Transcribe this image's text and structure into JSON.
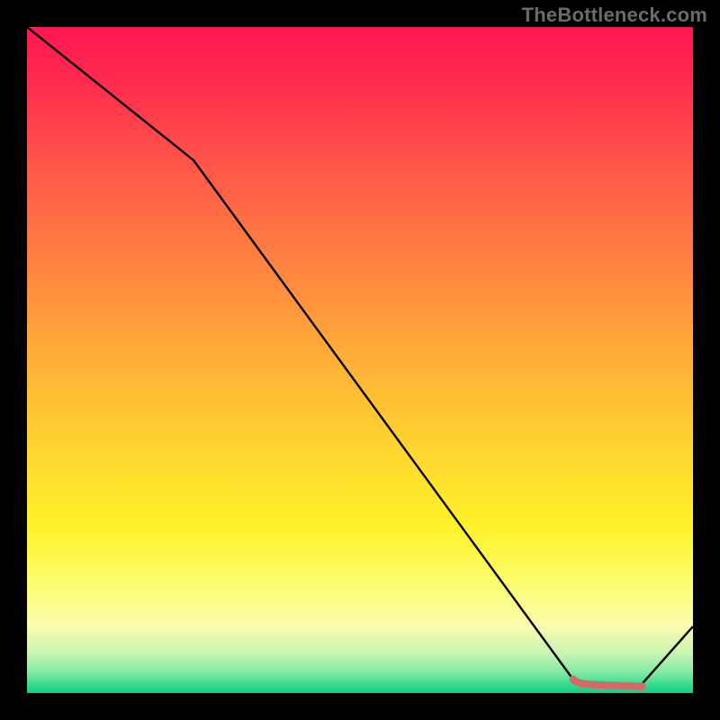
{
  "attribution": "TheBottleneck.com",
  "chart_data": {
    "type": "line",
    "title": "",
    "xlabel": "",
    "ylabel": "",
    "xlim": [
      0,
      100
    ],
    "ylim": [
      0,
      100
    ],
    "series": [
      {
        "name": "main-curve",
        "color": "#000000",
        "x": [
          0,
          25,
          82,
          88,
          92,
          100
        ],
        "values": [
          100,
          80,
          2,
          1,
          1,
          10
        ]
      },
      {
        "name": "highlight-optimal",
        "color": "#d36a6a",
        "x": [
          82,
          83,
          85,
          87,
          89,
          91,
          92
        ],
        "values": [
          2,
          1.5,
          1.2,
          1.1,
          1.05,
          1,
          1
        ]
      }
    ],
    "annotations": []
  },
  "colors": {
    "page_bg": "#000000",
    "curve": "#000000",
    "highlight": "#d36a6a",
    "attribution": "#6b6b6b"
  }
}
